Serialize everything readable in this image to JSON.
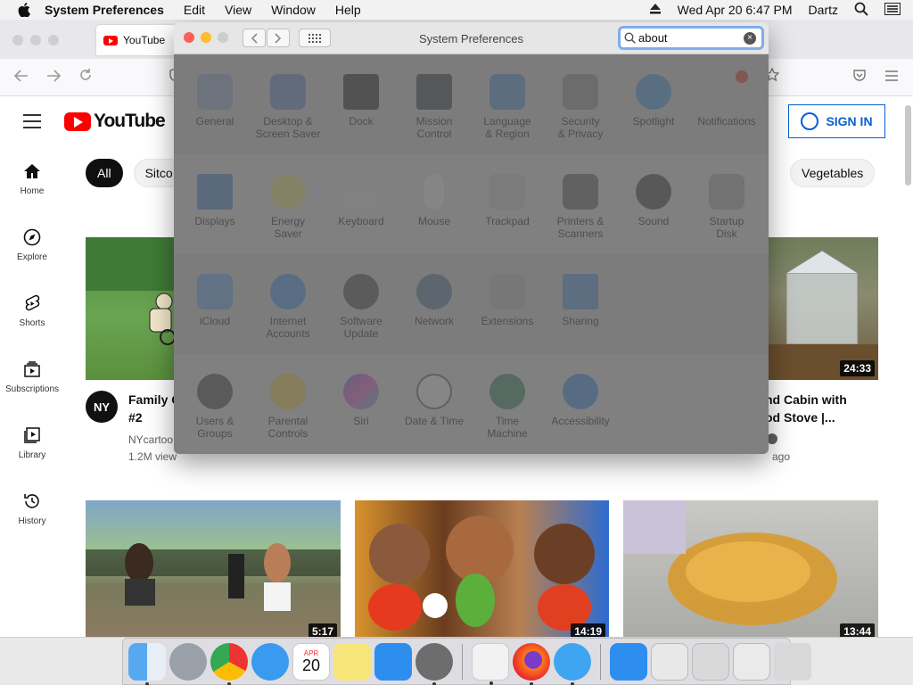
{
  "menubar": {
    "app_name": "System Preferences",
    "items": [
      "Edit",
      "View",
      "Window",
      "Help"
    ],
    "datetime": "Wed Apr 20  6:47 PM",
    "user": "Dartz"
  },
  "browser": {
    "tab_title": "YouTube"
  },
  "youtube": {
    "logo_text": "YouTube",
    "signin_label": "SIGN IN",
    "sidebar": [
      {
        "label": "Home",
        "icon": "home-icon"
      },
      {
        "label": "Explore",
        "icon": "compass-icon"
      },
      {
        "label": "Shorts",
        "icon": "shorts-icon"
      },
      {
        "label": "Subscriptions",
        "icon": "subscriptions-icon"
      },
      {
        "label": "Library",
        "icon": "library-icon"
      },
      {
        "label": "History",
        "icon": "history-icon"
      }
    ],
    "chips": [
      "All",
      "Sitco",
      "Vegetables"
    ],
    "videos": [
      {
        "title_line1": "Family G",
        "title_line2": "#2",
        "channel": "NYcartoo",
        "meta": "1.2M view",
        "avatar_text": "NY"
      },
      {
        "title_line1": "nd Cabin with",
        "title_line2": "od Stove |...",
        "meta": "ago",
        "duration": "24:33"
      },
      {
        "duration": "5:17"
      },
      {
        "duration": "14:19"
      },
      {
        "duration": "13:44"
      }
    ]
  },
  "sysprefs": {
    "title": "System Preferences",
    "search_value": "about",
    "rows": [
      [
        {
          "l1": "General",
          "l2": ""
        },
        {
          "l1": "Desktop &",
          "l2": "Screen Saver"
        },
        {
          "l1": "Dock",
          "l2": ""
        },
        {
          "l1": "Mission",
          "l2": "Control"
        },
        {
          "l1": "Language",
          "l2": "& Region"
        },
        {
          "l1": "Security",
          "l2": "& Privacy"
        },
        {
          "l1": "Spotlight",
          "l2": ""
        },
        {
          "l1": "Notifications",
          "l2": ""
        }
      ],
      [
        {
          "l1": "Displays",
          "l2": ""
        },
        {
          "l1": "Energy",
          "l2": "Saver"
        },
        {
          "l1": "Keyboard",
          "l2": ""
        },
        {
          "l1": "Mouse",
          "l2": ""
        },
        {
          "l1": "Trackpad",
          "l2": ""
        },
        {
          "l1": "Printers &",
          "l2": "Scanners"
        },
        {
          "l1": "Sound",
          "l2": ""
        },
        {
          "l1": "Startup",
          "l2": "Disk"
        }
      ],
      [
        {
          "l1": "iCloud",
          "l2": ""
        },
        {
          "l1": "Internet",
          "l2": "Accounts"
        },
        {
          "l1": "Software",
          "l2": "Update"
        },
        {
          "l1": "Network",
          "l2": ""
        },
        {
          "l1": "Extensions",
          "l2": ""
        },
        {
          "l1": "Sharing",
          "l2": ""
        }
      ],
      [
        {
          "l1": "Users &",
          "l2": "Groups"
        },
        {
          "l1": "Parental",
          "l2": "Controls"
        },
        {
          "l1": "Siri",
          "l2": ""
        },
        {
          "l1": "Date & Time",
          "l2": ""
        },
        {
          "l1": "Time",
          "l2": "Machine"
        },
        {
          "l1": "Accessibility",
          "l2": ""
        }
      ]
    ]
  },
  "dock": {
    "calendar_month": "APR",
    "calendar_day": "20"
  },
  "colors": {
    "youtube_red": "#ff0000",
    "signin_blue": "#065fd4",
    "search_focus": "#7faee8",
    "close": "#fe5f57",
    "minimize": "#febc2e",
    "zoom_disabled": "#cdcdcd"
  }
}
